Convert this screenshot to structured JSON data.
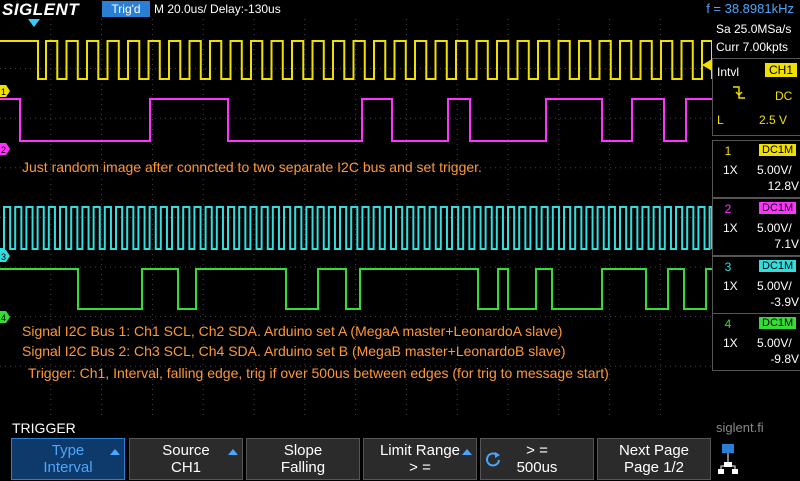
{
  "header": {
    "brand": "SIGLENT",
    "trigger_status": "Trig'd",
    "timebase": "M 20.0us/  Delay:-130us",
    "frequency": "f = 38.8981kHz"
  },
  "acquisition": {
    "sample_rate": "Sa 25.0MSa/s",
    "memory": "Curr 7.00kpts"
  },
  "trigger_panel": {
    "mode": "Intvl",
    "source": "CH1",
    "coupling": "DC",
    "level_label": "L",
    "level": "2.5 V"
  },
  "channels": [
    {
      "num": "1",
      "coupling": "DC1M",
      "probe": "1X",
      "scale": "5.00V/",
      "offset": "12.8V",
      "color": "#f0e000"
    },
    {
      "num": "2",
      "coupling": "DC1M",
      "probe": "1X",
      "scale": "5.00V/",
      "offset": "7.1V",
      "color": "#ff33ff"
    },
    {
      "num": "3",
      "coupling": "DC1M",
      "probe": "1X",
      "scale": "5.00V/",
      "offset": "-3.9V",
      "color": "#33dddd"
    },
    {
      "num": "4",
      "coupling": "DC1M",
      "probe": "1X",
      "scale": "5.00V/",
      "offset": "-9.8V",
      "color": "#33dd33"
    }
  ],
  "annotations": {
    "line1": "Just random image after conncted to two separate I2C bus and set trigger.",
    "line2": "Signal I2C Bus 1:  Ch1 SCL,  Ch2 SDA.  Arduino set A  (MegaA master+LeonardoA slave)",
    "line3": "Signal I2C Bus 2:  Ch3 SCL,  Ch4 SDA.  Arduino set B  (MegaB master+LeonardoB slave)",
    "line4": "Trigger: Ch1, Interval, falling edge, trig if over 500us between edges (for trig to message start)"
  },
  "menu": {
    "title": "TRIGGER",
    "softkeys": [
      {
        "line1": "Type",
        "line2": "Interval"
      },
      {
        "line1": "Source",
        "line2": "CH1"
      },
      {
        "line1": "Slope",
        "line2": "Falling"
      },
      {
        "line1": "Limit Range",
        "line2": "> ="
      },
      {
        "line1": "> =",
        "line2": "500us"
      },
      {
        "line1": "Next Page",
        "line2": "Page 1/2"
      }
    ]
  },
  "footer": {
    "website": "siglent.fi"
  },
  "colors": {
    "accent": "#2a7fd4",
    "trigger_yellow": "#f0e000",
    "note_orange": "#ff9933"
  }
}
